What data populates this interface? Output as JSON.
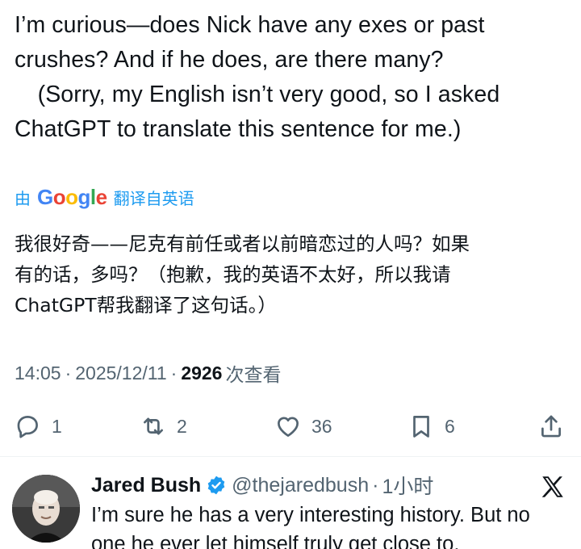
{
  "tweet": {
    "lines": [
      "I’m curious—does Nick have any exes or past",
      "crushes? And if he does, are there many?",
      "　(Sorry, my English isn’t very good, so I asked",
      "ChatGPT to translate this sentence for me.)"
    ]
  },
  "translation": {
    "by_label": "由",
    "provider": "Google",
    "action_label": "翻译自英语",
    "lines": [
      "我很好奇——尼克有前任或者以前暗恋过的人吗？如果",
      "有的话，多吗？（抱歉，我的英语不太好，所以我请",
      "ChatGPT帮我翻译了这句话。）"
    ]
  },
  "meta": {
    "time": "14:05",
    "separator1": "·",
    "date": "2025/12/11",
    "separator2": "·",
    "views_count": "2926",
    "views_label": "次查看"
  },
  "actions": {
    "replies": "1",
    "reposts": "2",
    "likes": "36",
    "bookmarks": "6"
  },
  "icons": {
    "reply": "reply-icon",
    "repost": "repost-icon",
    "like": "heart-icon",
    "bookmark": "bookmark-icon",
    "share": "share-icon",
    "verified": "verified-badge-icon",
    "platform": "x-logo-icon"
  },
  "colors": {
    "accent": "#1d9bf0",
    "muted": "#536471",
    "text": "#0f1419"
  },
  "reply": {
    "name": "Jared Bush",
    "handle": "@thejaredbush",
    "separator": "·",
    "time": "1小时",
    "lines": [
      "I’m sure he has a very interesting history. But no",
      "one he ever let himself truly get close to."
    ]
  }
}
